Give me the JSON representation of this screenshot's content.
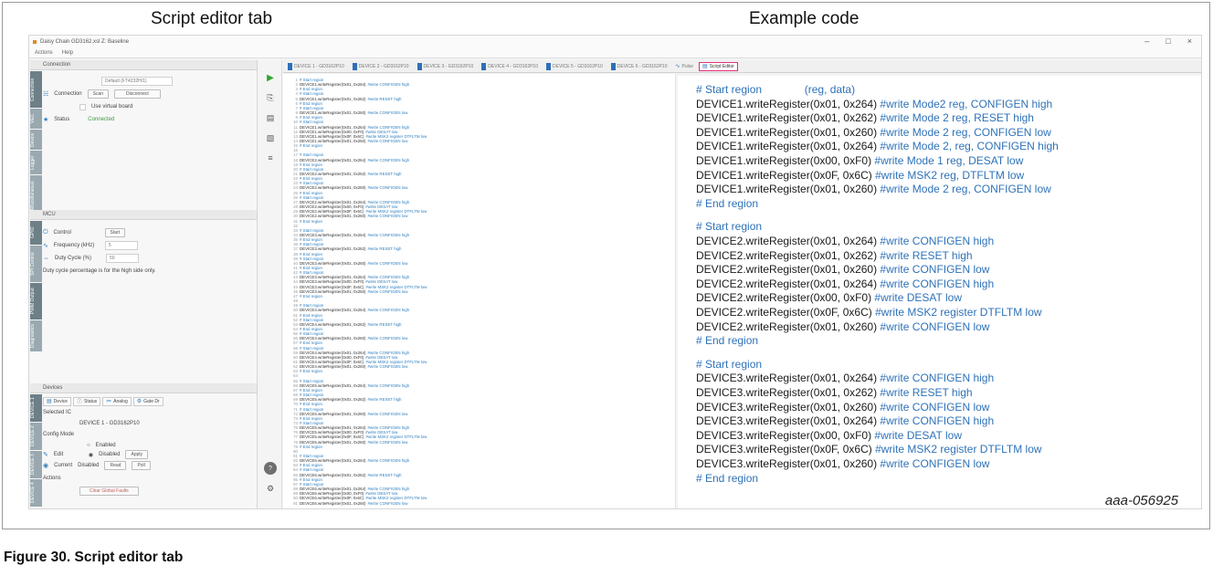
{
  "captions": {
    "left": "Script editor tab",
    "right": "Example code",
    "figure_id": "aaa-056925",
    "figure_caption": "Figure 30.  Script editor tab"
  },
  "window": {
    "title": "Daisy Chain GD3162.xsl  Z: Baseline",
    "menu": [
      "Actions",
      "Help"
    ],
    "controls": [
      "–",
      "□",
      "×"
    ]
  },
  "connection": {
    "header": "Connection",
    "vtabs": [
      "Connection",
      "VEC",
      "Device",
      "Logger",
      "Miscellaneous"
    ],
    "connect_label": "Connection",
    "port_value": "Default (FT4232H/1)",
    "scan_button": "Scan",
    "disconnect_button": "Disconnect",
    "virtual_label": "Use virtual board",
    "status_label": "Status",
    "status_value": "Connected"
  },
  "mcu": {
    "header": "MCU",
    "vtabs": [
      "GPIO",
      "SPI Control",
      "PWM Output",
      "Diagnostics"
    ],
    "control_label": "Control",
    "control_button": "Start",
    "frequency_label": "Frequency (kHz)",
    "frequency_value": "5",
    "duty_label": "Duty Cycle (%)",
    "duty_value": "50",
    "note": "Duty cycle percentage is for the high side only."
  },
  "devices": {
    "header": "Devices",
    "vtabs": [
      "DEVICE 1",
      "DEVICE 2",
      "DEVICE 3",
      "DEVICE 4"
    ],
    "subtabs": [
      "Device",
      "Status",
      "Analog",
      "Gate Dr"
    ],
    "selected_label": "Selected IC",
    "selected_value": "DEVICE 1 - GD3162P10",
    "config_label": "Config Mode",
    "edit_label": "Edit",
    "enabled_label": "Enabled",
    "disabled_label": "Disabled",
    "apply_button": "Apply",
    "current_label": "Current",
    "current_value": "Disabled",
    "read_button": "Read",
    "poll_button": "Poll",
    "actions_label": "Actions",
    "clear_button": "Clear Global Faults"
  },
  "tabs": [
    {
      "label": "DEVICE 1 - GD3162P10",
      "active": false
    },
    {
      "label": "DEVICE 2 - GD3162P10",
      "active": false
    },
    {
      "label": "DEVICE 3 - GD3162P10",
      "active": false
    },
    {
      "label": "DEVICE 4 - GD3162P10",
      "active": false
    },
    {
      "label": "DEVICE 5 - GD3162P10",
      "active": false
    },
    {
      "label": "DEVICE 6 - GD3162P10",
      "active": false
    },
    {
      "label": "Pulse",
      "active": false
    },
    {
      "label": "Script Editor",
      "active": true
    }
  ],
  "toolbar": {
    "run": "▶",
    "open": "⎘",
    "save": "▤",
    "save_as": "▧",
    "format": "≡",
    "help": "?",
    "settings": "⚙"
  },
  "code_lines": [
    {
      "n": "1",
      "code": "# Start region",
      "comment": ""
    },
    {
      "n": "2",
      "code": "DEVICE1.writeRegister(0x01, 0x264)",
      "comment": "#write CONFIGEN high"
    },
    {
      "n": "3",
      "code": "# End region",
      "comment": ""
    },
    {
      "n": "4",
      "code": "# Start region",
      "comment": ""
    },
    {
      "n": "5",
      "code": "DEVICE1.writeRegister(0x01, 0x262)",
      "comment": "#write RESET high"
    },
    {
      "n": "6",
      "code": "# End region",
      "comment": ""
    },
    {
      "n": "7",
      "code": "# Start region",
      "comment": ""
    },
    {
      "n": "8",
      "code": "DEVICE1.writeRegister(0x01, 0x260)",
      "comment": "#write CONFIGEN low"
    },
    {
      "n": "9",
      "code": "# End region",
      "comment": ""
    },
    {
      "n": "10",
      "code": "# Start region",
      "comment": ""
    },
    {
      "n": "11",
      "code": "DEVICE1.writeRegister(0x01, 0x264)",
      "comment": "#write CONFIGEN high"
    },
    {
      "n": "12",
      "code": "DEVICE1.writeRegister(0x00, 0xF0)",
      "comment": "#write DESAT low"
    },
    {
      "n": "13",
      "code": "DEVICE1.writeRegister(0x0F, 0x6C)",
      "comment": "#write MSK2 register DTFLTM low"
    },
    {
      "n": "14",
      "code": "DEVICE1.writeRegister(0x01, 0x260)",
      "comment": "#write CONFIGEN low"
    },
    {
      "n": "15",
      "code": "# End region",
      "comment": ""
    },
    {
      "n": "16",
      "code": "",
      "comment": ""
    },
    {
      "n": "17",
      "code": "# Start region",
      "comment": ""
    },
    {
      "n": "18",
      "code": "DEVICE2.writeRegister(0x01, 0x264)",
      "comment": "#write CONFIGEN high"
    },
    {
      "n": "19",
      "code": "# End region",
      "comment": ""
    },
    {
      "n": "20",
      "code": "# Start region",
      "comment": ""
    },
    {
      "n": "21",
      "code": "DEVICE2.writeRegister(0x01, 0x262)",
      "comment": "#write RESET high"
    },
    {
      "n": "22",
      "code": "# End region",
      "comment": ""
    },
    {
      "n": "23",
      "code": "# Start region",
      "comment": ""
    },
    {
      "n": "24",
      "code": "DEVICE2.writeRegister(0x01, 0x260)",
      "comment": "#write CONFIGEN low"
    },
    {
      "n": "25",
      "code": "# End region",
      "comment": ""
    },
    {
      "n": "26",
      "code": "# Start region",
      "comment": ""
    },
    {
      "n": "27",
      "code": "DEVICE2.writeRegister(0x01, 0x264)",
      "comment": "#write CONFIGEN high"
    },
    {
      "n": "28",
      "code": "DEVICE2.writeRegister(0x00, 0xF0)",
      "comment": "#write DESAT low"
    },
    {
      "n": "29",
      "code": "DEVICE2.writeRegister(0x0F, 0x6C)",
      "comment": "#write MSK2 register DTFLTM low"
    },
    {
      "n": "30",
      "code": "DEVICE2.writeRegister(0x01, 0x260)",
      "comment": "#write CONFIGEN low"
    },
    {
      "n": "31",
      "code": "# End region",
      "comment": ""
    },
    {
      "n": "32",
      "code": "",
      "comment": ""
    },
    {
      "n": "33",
      "code": "# Start region",
      "comment": ""
    },
    {
      "n": "34",
      "code": "DEVICE3.writeRegister(0x01, 0x264)",
      "comment": "#write CONFIGEN high"
    },
    {
      "n": "35",
      "code": "# End region",
      "comment": ""
    },
    {
      "n": "36",
      "code": "# Start region",
      "comment": ""
    },
    {
      "n": "37",
      "code": "DEVICE3.writeRegister(0x01, 0x262)",
      "comment": "#write RESET high"
    },
    {
      "n": "38",
      "code": "# End region",
      "comment": ""
    },
    {
      "n": "39",
      "code": "# Start region",
      "comment": ""
    },
    {
      "n": "40",
      "code": "DEVICE3.writeRegister(0x01, 0x260)",
      "comment": "#write CONFIGEN low"
    },
    {
      "n": "41",
      "code": "# End region",
      "comment": ""
    },
    {
      "n": "42",
      "code": "# Start region",
      "comment": ""
    },
    {
      "n": "43",
      "code": "DEVICE3.writeRegister(0x01, 0x264)",
      "comment": "#write CONFIGEN high"
    },
    {
      "n": "44",
      "code": "DEVICE3.writeRegister(0x00, 0xF0)",
      "comment": "#write DESAT low"
    },
    {
      "n": "45",
      "code": "DEVICE3.writeRegister(0x0F, 0x6C)",
      "comment": "#write MSK2 register DTFLTM low"
    },
    {
      "n": "46",
      "code": "DEVICE3.writeRegister(0x01, 0x260)",
      "comment": "#write CONFIGEN low"
    },
    {
      "n": "47",
      "code": "# End region",
      "comment": ""
    },
    {
      "n": "48",
      "code": "",
      "comment": ""
    },
    {
      "n": "49",
      "code": "# Start region",
      "comment": ""
    },
    {
      "n": "50",
      "code": "DEVICE4.writeRegister(0x01, 0x264)",
      "comment": "#write CONFIGEN high"
    },
    {
      "n": "51",
      "code": "# End region",
      "comment": ""
    },
    {
      "n": "52",
      "code": "# Start region",
      "comment": ""
    },
    {
      "n": "53",
      "code": "DEVICE4.writeRegister(0x01, 0x262)",
      "comment": "#write RESET high"
    },
    {
      "n": "54",
      "code": "# End region",
      "comment": ""
    },
    {
      "n": "55",
      "code": "# Start region",
      "comment": ""
    },
    {
      "n": "56",
      "code": "DEVICE4.writeRegister(0x01, 0x260)",
      "comment": "#write CONFIGEN low"
    },
    {
      "n": "57",
      "code": "# End region",
      "comment": ""
    },
    {
      "n": "58",
      "code": "# Start region",
      "comment": ""
    },
    {
      "n": "59",
      "code": "DEVICE4.writeRegister(0x01, 0x264)",
      "comment": "#write CONFIGEN high"
    },
    {
      "n": "60",
      "code": "DEVICE4.writeRegister(0x00, 0xF0)",
      "comment": "#write DESAT low"
    },
    {
      "n": "61",
      "code": "DEVICE4.writeRegister(0x0F, 0x6C)",
      "comment": "#write MSK2 register DTFLTM low"
    },
    {
      "n": "62",
      "code": "DEVICE4.writeRegister(0x01, 0x260)",
      "comment": "#write CONFIGEN low"
    },
    {
      "n": "63",
      "code": "# End region",
      "comment": ""
    },
    {
      "n": "64",
      "code": "",
      "comment": ""
    },
    {
      "n": "65",
      "code": "# Start region",
      "comment": ""
    },
    {
      "n": "66",
      "code": "DEVICE5.writeRegister(0x01, 0x264)",
      "comment": "#write CONFIGEN high"
    },
    {
      "n": "67",
      "code": "# End region",
      "comment": ""
    },
    {
      "n": "68",
      "code": "# Start region",
      "comment": ""
    },
    {
      "n": "69",
      "code": "DEVICE5.writeRegister(0x01, 0x262)",
      "comment": "#write RESET high"
    },
    {
      "n": "70",
      "code": "# End region",
      "comment": ""
    },
    {
      "n": "71",
      "code": "# Start region",
      "comment": ""
    },
    {
      "n": "72",
      "code": "DEVICE5.writeRegister(0x01, 0x260)",
      "comment": "#write CONFIGEN low"
    },
    {
      "n": "73",
      "code": "# End region",
      "comment": ""
    },
    {
      "n": "74",
      "code": "# Start region",
      "comment": ""
    },
    {
      "n": "75",
      "code": "DEVICE5.writeRegister(0x01, 0x264)",
      "comment": "#write CONFIGEN high"
    },
    {
      "n": "76",
      "code": "DEVICE5.writeRegister(0x00, 0xF0)",
      "comment": "#write DESAT low"
    },
    {
      "n": "77",
      "code": "DEVICE5.writeRegister(0x0F, 0x6C)",
      "comment": "#write MSK2 register DTFLTM low"
    },
    {
      "n": "78",
      "code": "DEVICE5.writeRegister(0x01, 0x260)",
      "comment": "#write CONFIGEN low"
    },
    {
      "n": "79",
      "code": "# End region",
      "comment": ""
    },
    {
      "n": "80",
      "code": "",
      "comment": ""
    },
    {
      "n": "81",
      "code": "# Start region",
      "comment": ""
    },
    {
      "n": "82",
      "code": "DEVICE6.writeRegister(0x01, 0x264)",
      "comment": "#write CONFIGEN high"
    },
    {
      "n": "83",
      "code": "# End region",
      "comment": ""
    },
    {
      "n": "84",
      "code": "# Start region",
      "comment": ""
    },
    {
      "n": "85",
      "code": "DEVICE6.writeRegister(0x01, 0x262)",
      "comment": "#write RESET high"
    },
    {
      "n": "86",
      "code": "# End region",
      "comment": ""
    },
    {
      "n": "87",
      "code": "# Start region",
      "comment": ""
    },
    {
      "n": "88",
      "code": "DEVICE6.writeRegister(0x01, 0x264)",
      "comment": "#write CONFIGEN high"
    },
    {
      "n": "89",
      "code": "DEVICE6.writeRegister(0x00, 0xF0)",
      "comment": "#write DESAT low"
    },
    {
      "n": "90",
      "code": "DEVICE6.writeRegister(0x0F, 0x6C)",
      "comment": "#write MSK2 register DTFLTM low"
    },
    {
      "n": "91",
      "code": "DEVICE6.writeRegister(0x01, 0x260)",
      "comment": "#write CONFIGEN low"
    }
  ],
  "example_lines": [
    {
      "code": "# Start region",
      "comment": "              (reg, data)",
      "region": true
    },
    {
      "code": "DEVICE1.writeRegister(0x01, 0x264)",
      "comment": " #write Mode2 reg, CONFIGEN high",
      "region": false
    },
    {
      "code": "DEVICE1.writeRegister(0x01, 0x262)",
      "comment": " #write Mode 2 reg, RESET high",
      "region": false
    },
    {
      "code": "DEVICE1.writeRegister(0x01, 0x260)",
      "comment": " #write Mode 2 reg, CONFIGEN low",
      "region": false
    },
    {
      "code": "DEVICE1.writeRegister(0x01, 0x264)",
      "comment": " #write Mode 2, reg, CONFIGEN high",
      "region": false
    },
    {
      "code": "DEVICE1.writeRegister(0x00, 0xF0)",
      "comment": " #write Mode 1 reg, DESAT low",
      "region": false
    },
    {
      "code": "DEVICE1.writeRegister(0x0F, 0x6C)",
      "comment": " #write MSK2 reg, DTFLTM low",
      "region": false
    },
    {
      "code": "DEVICE1.writeRegister(0x01, 0x260)",
      "comment": " #write Mode 2 reg, CONFIGEN low",
      "region": false
    },
    {
      "code": "# End region",
      "comment": "",
      "region": true
    },
    {
      "code": "",
      "comment": "",
      "region": false
    },
    {
      "code": "# Start region",
      "comment": "",
      "region": true
    },
    {
      "code": "DEVICE2.writeRegister(0x01, 0x264)",
      "comment": " #write CONFIGEN high",
      "region": false
    },
    {
      "code": "DEVICE2.writeRegister(0x01, 0x262)",
      "comment": " #write RESET high",
      "region": false
    },
    {
      "code": "DEVICE2.writeRegister(0x01, 0x260)",
      "comment": " #write CONFIGEN low",
      "region": false
    },
    {
      "code": "DEVICE2.writeRegister(0x01, 0x264)",
      "comment": " #write CONFIGEN high",
      "region": false
    },
    {
      "code": "DEVICE2.writeRegister(0x00, 0xF0)",
      "comment": " #write DESAT low",
      "region": false
    },
    {
      "code": "DEVICE2.writeRegister(0x0F, 0x6C)",
      "comment": " #write MSK2 register DTFLTM low",
      "region": false
    },
    {
      "code": "DEVICE2.writeRegister(0x01, 0x260)",
      "comment": " #write CONFIGEN low",
      "region": false
    },
    {
      "code": "# End region",
      "comment": "",
      "region": true
    },
    {
      "code": "",
      "comment": "",
      "region": false
    },
    {
      "code": "# Start region",
      "comment": "",
      "region": true
    },
    {
      "code": "DEVICE3.writeRegister(0x01, 0x264)",
      "comment": " #write CONFIGEN high",
      "region": false
    },
    {
      "code": "DEVICE3.writeRegister(0x01, 0x262)",
      "comment": " #write RESET high",
      "region": false
    },
    {
      "code": "DEVICE3.writeRegister(0x01, 0x260)",
      "comment": " #write CONFIGEN low",
      "region": false
    },
    {
      "code": "DEVICE3.writeRegister(0x01, 0x264)",
      "comment": " #write CONFIGEN high",
      "region": false
    },
    {
      "code": "DEVICE3.writeRegister(0x00, 0xF0)",
      "comment": " #write DESAT low",
      "region": false
    },
    {
      "code": "DEVICE3.writeRegister(0x0F, 0x6C)",
      "comment": " #write MSK2 register DTFLTM low",
      "region": false
    },
    {
      "code": "DEVICE3.writeRegister(0x01, 0x260)",
      "comment": " #write CONFIGEN low",
      "region": false
    },
    {
      "code": "# End region",
      "comment": "",
      "region": true
    }
  ]
}
